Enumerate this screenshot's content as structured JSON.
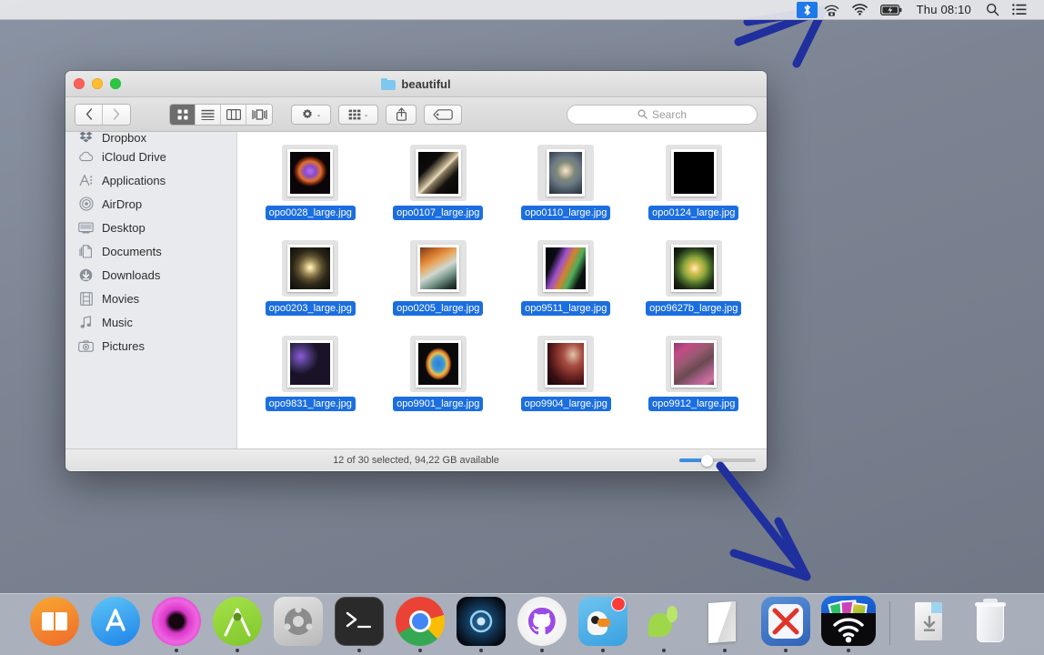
{
  "menubar": {
    "icons": [
      {
        "name": "bluetooth-highlight-icon",
        "glyph": "bt"
      },
      {
        "name": "wifi-camera-icon",
        "glyph": "wifi-cam"
      },
      {
        "name": "wifi-icon",
        "glyph": "wifi"
      },
      {
        "name": "battery-charging-icon",
        "glyph": "battery"
      }
    ],
    "clock": "Thu 08:10",
    "spotlight_icon": "search-icon",
    "notification_icon": "list-icon"
  },
  "finder": {
    "title": "beautiful",
    "traffic_lights": {
      "close": "close-button",
      "minimize": "minimize-button",
      "maximize": "maximize-button"
    },
    "toolbar": {
      "back_label": "‹",
      "forward_label": "›",
      "view_modes": [
        {
          "name": "icon-view-button",
          "active": true
        },
        {
          "name": "list-view-button",
          "active": false
        },
        {
          "name": "column-view-button",
          "active": false
        },
        {
          "name": "coverflow-view-button",
          "active": false
        }
      ],
      "action_button": "gear-icon",
      "arrange_button": "arrange-icon",
      "share_button": "share-icon",
      "tag_button": "tag-icon",
      "chevron": "⌄"
    },
    "search": {
      "placeholder": "Search",
      "value": "",
      "icon": "search-icon"
    },
    "sidebar": {
      "items": [
        {
          "label": "Dropbox",
          "icon": "dropbox-icon",
          "clipped": true
        },
        {
          "label": "iCloud Drive",
          "icon": "cloud-icon",
          "clipped": false
        },
        {
          "label": "Applications",
          "icon": "applications-icon",
          "clipped": false
        },
        {
          "label": "AirDrop",
          "icon": "airdrop-icon",
          "clipped": false
        },
        {
          "label": "Desktop",
          "icon": "desktop-icon",
          "clipped": false
        },
        {
          "label": "Documents",
          "icon": "documents-icon",
          "clipped": false
        },
        {
          "label": "Downloads",
          "icon": "downloads-icon",
          "clipped": false
        },
        {
          "label": "Movies",
          "icon": "movies-icon",
          "clipped": false
        },
        {
          "label": "Music",
          "icon": "music-icon",
          "clipped": false
        },
        {
          "label": "Pictures",
          "icon": "pictures-icon",
          "clipped": false
        }
      ]
    },
    "files": [
      {
        "name": "opo0028_large.jpg",
        "selected": true,
        "thumb": "nebula-purple-ring"
      },
      {
        "name": "opo0107_large.jpg",
        "selected": true,
        "thumb": "edge-on-galaxy"
      },
      {
        "name": "opo0110_large.jpg",
        "selected": true,
        "thumb": "spiral-galaxy"
      },
      {
        "name": "opo0124_large.jpg",
        "selected": true,
        "thumb": "mars-planet"
      },
      {
        "name": "opo0203_large.jpg",
        "selected": true,
        "thumb": "light-echo-rings"
      },
      {
        "name": "opo0205_large.jpg",
        "selected": true,
        "thumb": "orange-nebula-cloud"
      },
      {
        "name": "opo9511_large.jpg",
        "selected": true,
        "thumb": "colorful-nebula-pillars"
      },
      {
        "name": "opo9627b_large.jpg",
        "selected": true,
        "thumb": "green-gold-nebula"
      },
      {
        "name": "opo9831_large.jpg",
        "selected": true,
        "thumb": "bubble-nebula"
      },
      {
        "name": "opo9901_large.jpg",
        "selected": true,
        "thumb": "ring-nebula"
      },
      {
        "name": "opo9904_large.jpg",
        "selected": true,
        "thumb": "red-dust-nebula"
      },
      {
        "name": "opo9912_large.jpg",
        "selected": true,
        "thumb": "pink-magenta-nebula"
      }
    ],
    "statusbar": {
      "text": "12 of 30 selected, 94,22 GB available",
      "zoom_slider_value": 30
    }
  },
  "annotations": {
    "color": "#1f2f9e",
    "arrows": [
      {
        "name": "arrow-to-menubar-wifi",
        "direction": "up-right"
      },
      {
        "name": "arrow-to-dock-wifi-app",
        "direction": "down-right"
      }
    ]
  },
  "dock": {
    "apps": [
      {
        "name": "ibooks-icon",
        "running": false
      },
      {
        "name": "app-store-icon",
        "running": false
      },
      {
        "name": "flower-app-icon",
        "running": true
      },
      {
        "name": "android-studio-icon",
        "running": true
      },
      {
        "name": "unity-icon",
        "running": false
      },
      {
        "name": "terminal-icon",
        "running": true
      },
      {
        "name": "google-chrome-icon",
        "running": true
      },
      {
        "name": "dark-circle-app-icon",
        "running": true
      },
      {
        "name": "github-desktop-icon",
        "running": true
      },
      {
        "name": "duckduckgo-icon",
        "running": true,
        "badge": true
      },
      {
        "name": "green-leaf-app-icon",
        "running": true
      },
      {
        "name": "white-paper-app-icon",
        "running": true
      },
      {
        "name": "xmind-icon",
        "running": true
      },
      {
        "name": "airbeam-wifi-photo-app-icon",
        "running": true
      }
    ],
    "separator": true,
    "right_items": [
      {
        "name": "downloads-stack-icon",
        "running": false
      },
      {
        "name": "trash-icon",
        "running": false
      }
    ]
  }
}
